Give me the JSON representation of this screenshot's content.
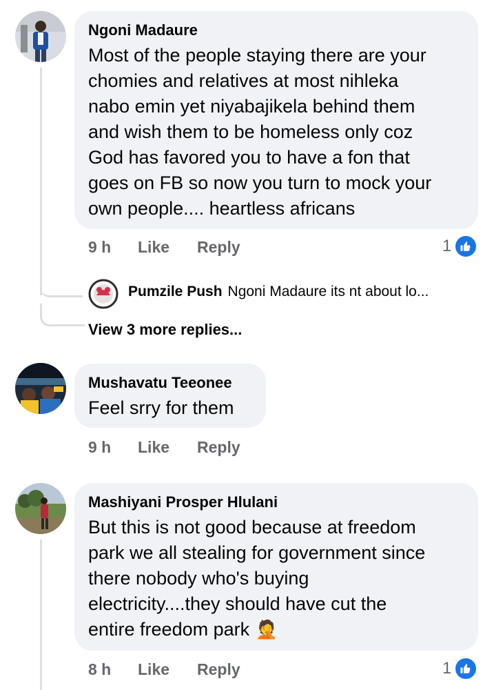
{
  "comments": [
    {
      "author": "Ngoni Madaure",
      "text": "Most of the people staying there are your\nchomies and relatives at most nihleka\nnabo emin yet niyabajikela behind them\nand wish them to be homeless only coz\nGod has favored you to have a fon that\ngoes on FB so now you turn to mock your\nown people.... heartless africans",
      "time": "9 h",
      "like_label": "Like",
      "reply_label": "Reply",
      "reaction_count": "1",
      "reply_preview": {
        "author": "Pumzile Push",
        "text": "Ngoni Madaure its nt about  lo..."
      },
      "view_more": "View 3 more replies..."
    },
    {
      "author": "Mushavatu Teeonee",
      "text": "Feel srry for them",
      "time": "9 h",
      "like_label": "Like",
      "reply_label": "Reply"
    },
    {
      "author": "Mashiyani Prosper Hlulani",
      "text": "But this is not good because at freedom\npark we all stealing for government since\nthere nobody who's buying\nelectricity....they should have cut the\nentire freedom park",
      "emoji": "🤦",
      "time": "8 h",
      "like_label": "Like",
      "reply_label": "Reply",
      "reaction_count": "1"
    }
  ],
  "icons": {
    "reaction": "like-thumb-icon",
    "facepalm": "facepalm-emoji-icon"
  },
  "colors": {
    "bubble": "#f0f2f5",
    "meta": "#65676b",
    "like_blue": "#1b74e4",
    "thread_line": "#dcdde1"
  }
}
